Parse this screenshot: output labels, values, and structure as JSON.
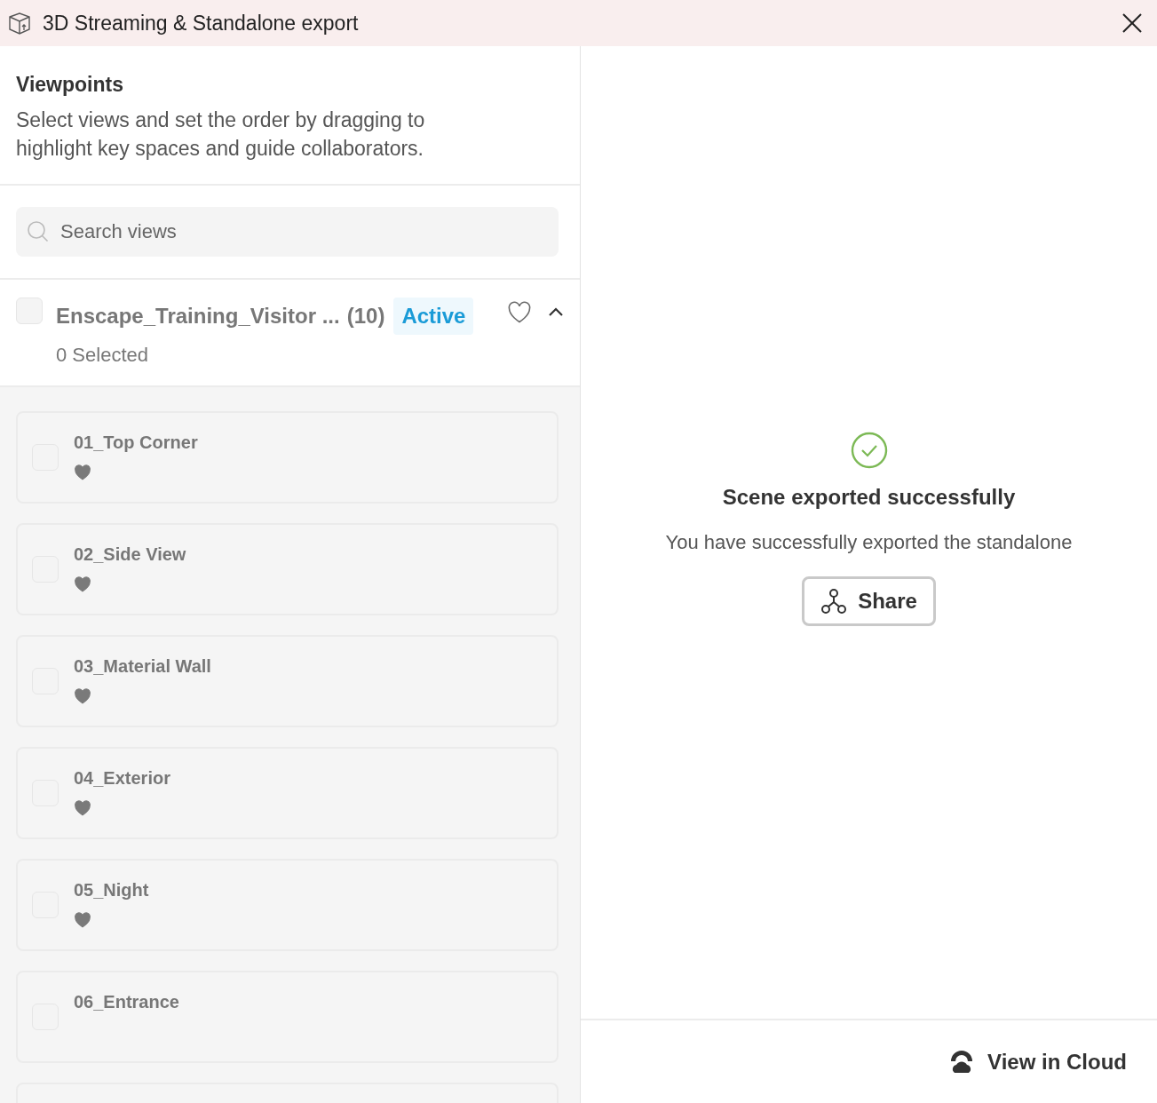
{
  "window": {
    "title": "3D Streaming & Standalone export"
  },
  "viewpoints": {
    "title": "Viewpoints",
    "description": "Select views and set the order by dragging to highlight key spaces and guide collaborators."
  },
  "search": {
    "placeholder": "Search views"
  },
  "group": {
    "name": "Enscape_Training_Visitor ...",
    "count": "(10)",
    "badge": "Active",
    "selected_label": "0 Selected",
    "checked": false,
    "favorite": false,
    "expanded": true
  },
  "views": [
    {
      "name": "01_Top Corner",
      "checked": false,
      "favorite": true
    },
    {
      "name": "02_Side View",
      "checked": false,
      "favorite": true
    },
    {
      "name": "03_Material Wall",
      "checked": false,
      "favorite": true
    },
    {
      "name": "04_Exterior",
      "checked": false,
      "favorite": true
    },
    {
      "name": "05_Night",
      "checked": false,
      "favorite": true
    },
    {
      "name": "06_Entrance",
      "checked": false,
      "favorite": false
    }
  ],
  "result": {
    "title": "Scene exported successfully",
    "message": "You have successfully exported the standalone",
    "share_button": "Share"
  },
  "footer": {
    "cloud_button": "View in Cloud"
  }
}
